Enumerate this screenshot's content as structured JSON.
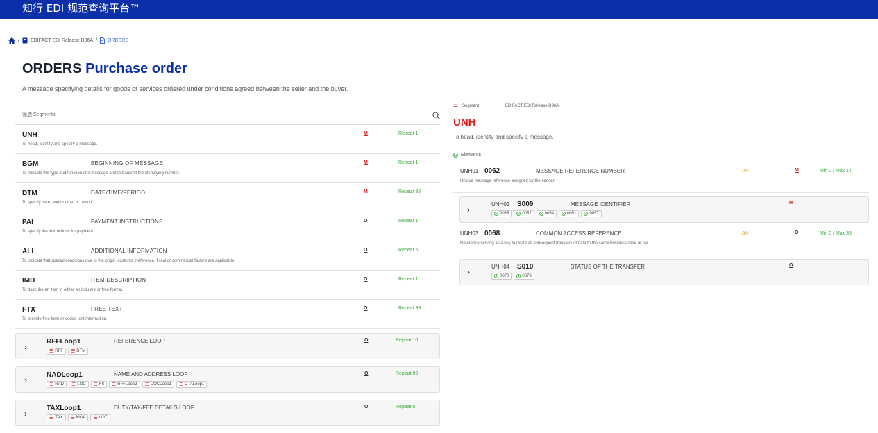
{
  "header": {
    "title": "知行 EDI 规范查询平台™"
  },
  "breadcrumb": {
    "release": "EDIFACT EDI Release D96A",
    "current": "ORDERS"
  },
  "page": {
    "code": "ORDERS",
    "name": "Purchase order",
    "description": "A message specifying details for goods or services ordered under conditions agreed between the seller and the buyer."
  },
  "filter": {
    "label": "筛选 Segments"
  },
  "segments": [
    {
      "code": "UNH",
      "name": "",
      "desc": "To head, identify and specify a message.",
      "req": "M",
      "repeat": "Repeat 1"
    },
    {
      "code": "BGM",
      "name": "BEGINNING OF MESSAGE",
      "desc": "To indicate the type and function of a message and to transmit the identifying number.",
      "req": "M",
      "repeat": "Repeat 1"
    },
    {
      "code": "DTM",
      "name": "DATE/TIME/PERIOD",
      "desc": "To specify date, and/or time, or period.",
      "req": "M",
      "repeat": "Repeat 35"
    },
    {
      "code": "PAI",
      "name": "PAYMENT INSTRUCTIONS",
      "desc": "To specify the instructions for payment.",
      "req": "O",
      "repeat": "Repeat 1"
    },
    {
      "code": "ALI",
      "name": "ADDITIONAL INFORMATION",
      "desc": "To indicate that special conditions due to the origin, customs preference, fiscal or commercial factors are applicable.",
      "req": "O",
      "repeat": "Repeat 5"
    },
    {
      "code": "IMD",
      "name": "ITEM DESCRIPTION",
      "desc": "To describe an item in either an industry or free format.",
      "req": "O",
      "repeat": "Repeat 1"
    },
    {
      "code": "FTX",
      "name": "FREE TEXT",
      "desc": "To provide free form or coded text information.",
      "req": "O",
      "repeat": "Repeat 99"
    }
  ],
  "loops": [
    {
      "code": "RFFLoop1",
      "name": "REFERENCE LOOP",
      "req": "O",
      "repeat": "Repeat 10",
      "tags": [
        "RFF",
        "DTM"
      ]
    },
    {
      "code": "NADLoop1",
      "name": "NAME AND ADDRESS LOOP",
      "req": "O",
      "repeat": "Repeat 99",
      "tags": [
        "NAD",
        "LOC",
        "FII",
        "RFFLoop2",
        "DOCLoop1",
        "CTALoop1"
      ]
    },
    {
      "code": "TAXLoop1",
      "name": "DUTY/TAX/FEE DETAILS LOOP",
      "req": "O",
      "repeat": "Repeat 5",
      "tags": [
        "TAX",
        "MOA",
        "LOC"
      ]
    }
  ],
  "detail": {
    "segment_label": "Segment",
    "release": "EDIFACT EDI Release D96A",
    "code": "UNH",
    "description": "To head, identify and specify a message.",
    "elements_label": "Elements",
    "elements": [
      {
        "pos": "UNH01",
        "code": "0062",
        "name": "MESSAGE REFERENCE NUMBER",
        "desc": "Unique message reference assigned by the sender.",
        "type": "AN",
        "req": "M",
        "minmax": "Min 0 / Max 14"
      },
      {
        "pos": "UNH03",
        "code": "0068",
        "name": "COMMON ACCESS REFERENCE",
        "desc": "Reference serving as a key to relate all subsequent transfers of data to the same business case or file.",
        "type": "AN",
        "req": "O",
        "minmax": "Min 0 / Max 35"
      }
    ],
    "composites": [
      {
        "pos": "UNH02",
        "code": "S009",
        "name": "MESSAGE IDENTIFIER",
        "req": "M",
        "tags": [
          "0065",
          "0052",
          "0054",
          "0051",
          "0057"
        ]
      },
      {
        "pos": "UNH04",
        "code": "S010",
        "name": "STATUS OF THE TRANSFER",
        "req": "O",
        "tags": [
          "0070",
          "0073"
        ]
      }
    ]
  },
  "colors": {
    "header_bg": "#0a2fa8",
    "mandatory": "#d81b1b",
    "repeat": "#39a939",
    "type": "#e8a31a"
  }
}
